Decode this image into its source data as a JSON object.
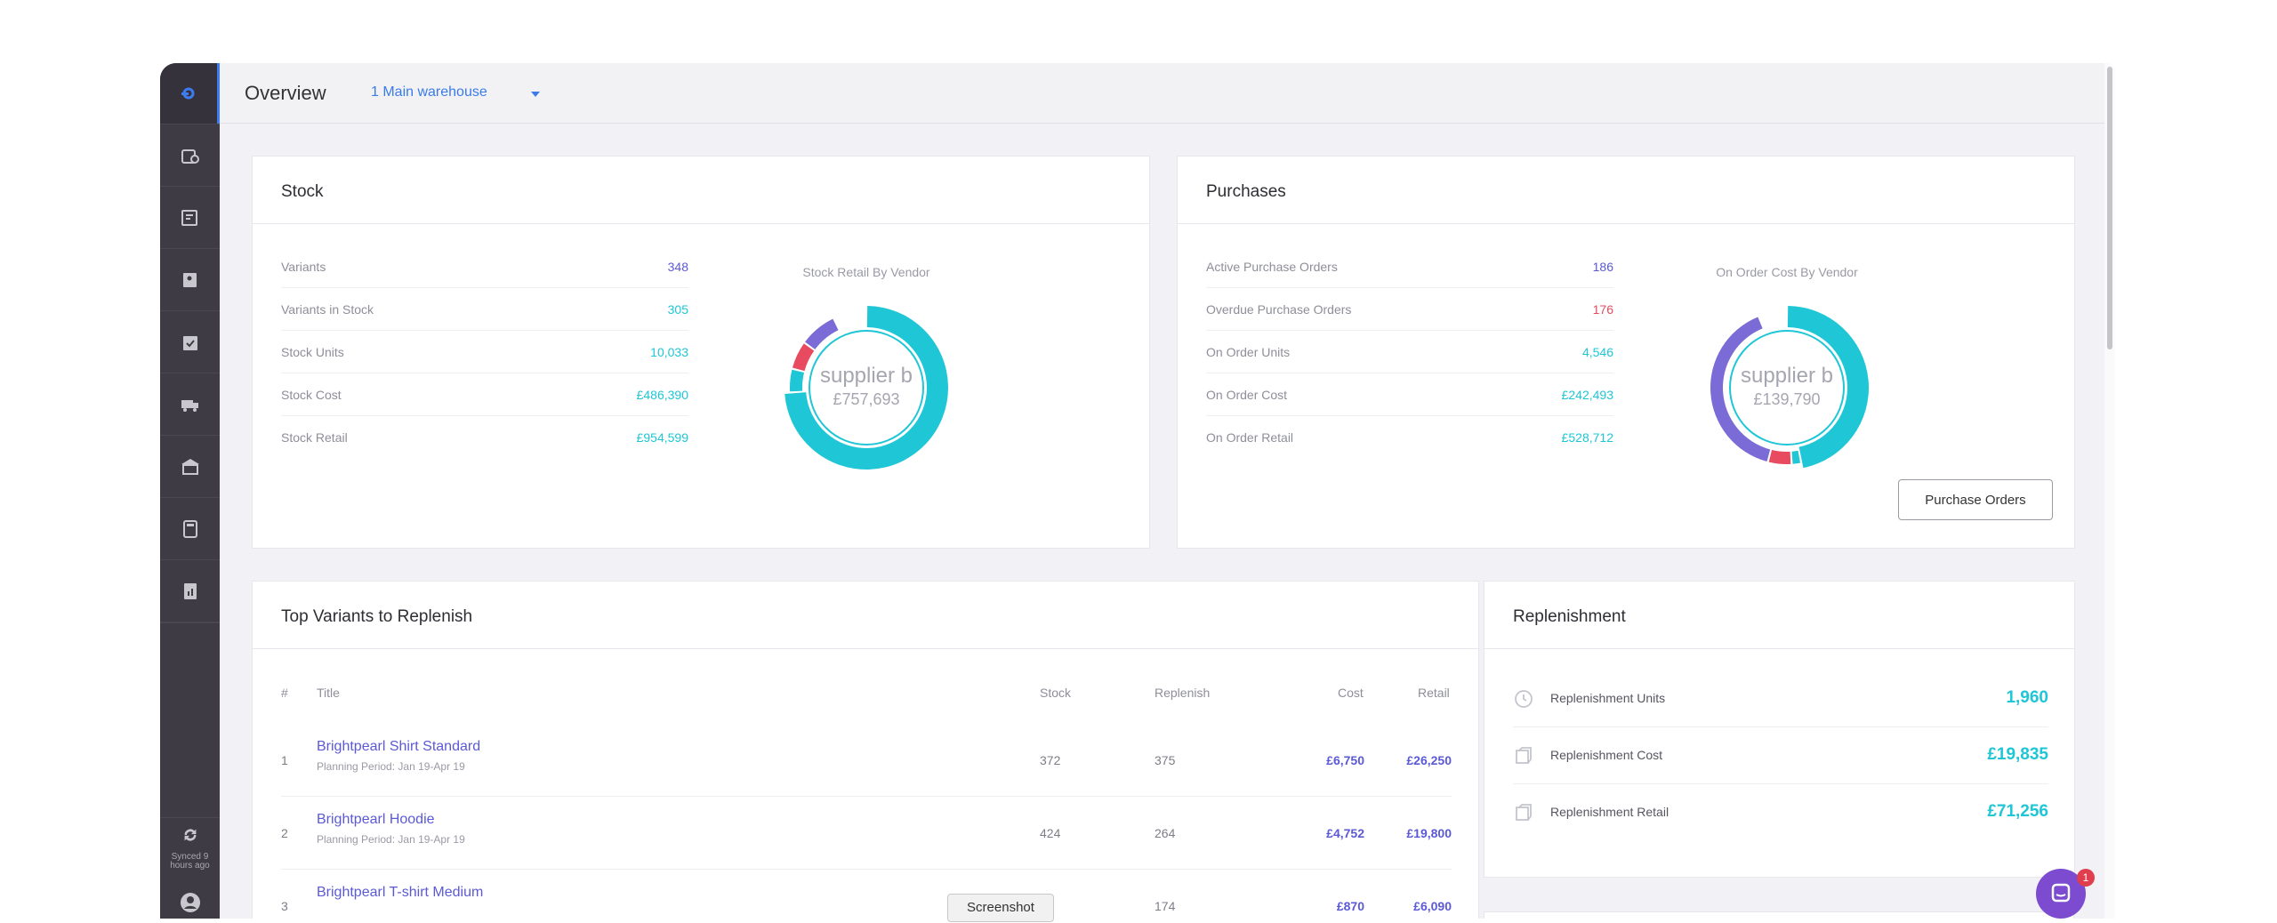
{
  "header": {
    "title": "Overview",
    "warehouse": "1 Main warehouse"
  },
  "sidebar": {
    "sync_label": "Synced 9 hours ago",
    "items": [
      "stock-icon",
      "orders-icon",
      "vendors-icon",
      "checklist-icon",
      "shipping-icon",
      "warehouse-icon",
      "calculator-icon",
      "reports-icon"
    ]
  },
  "stock": {
    "title": "Stock",
    "metrics": [
      {
        "label": "Variants",
        "value": "348",
        "color": "#5b59d6"
      },
      {
        "label": "Variants in Stock",
        "value": "305",
        "color": "#1ec6d6"
      },
      {
        "label": "Stock Units",
        "value": "10,033",
        "color": "#1ec6d6"
      },
      {
        "label": "Stock Cost",
        "value": "£486,390",
        "color": "#1ec6d6"
      },
      {
        "label": "Stock Retail",
        "value": "£954,599",
        "color": "#1ec6d6"
      }
    ],
    "donut": {
      "title": "Stock Retail By Vendor",
      "center_name": "supplier b",
      "center_value": "£757,693",
      "segments": [
        {
          "color": "#1ec6d6",
          "fraction": 0.74
        },
        {
          "color": "#1ec6d6",
          "fraction": 0.05
        },
        {
          "color": "#e84a60",
          "fraction": 0.06
        },
        {
          "color": "#7b6bd6",
          "fraction": 0.08
        }
      ]
    }
  },
  "purchases": {
    "title": "Purchases",
    "metrics": [
      {
        "label": "Active Purchase Orders",
        "value": "186",
        "color": "#5b59d6"
      },
      {
        "label": "Overdue Purchase Orders",
        "value": "176",
        "color": "#e84a60"
      },
      {
        "label": "On Order Units",
        "value": "4,546",
        "color": "#1ec6d6"
      },
      {
        "label": "On Order Cost",
        "value": "£242,493",
        "color": "#1ec6d6"
      },
      {
        "label": "On Order Retail",
        "value": "£528,712",
        "color": "#1ec6d6"
      }
    ],
    "donut": {
      "title": "On Order Cost By Vendor",
      "center_name": "supplier b",
      "center_value": "£139,790",
      "segments": [
        {
          "color": "#1ec6d6",
          "fraction": 0.47
        },
        {
          "color": "#1ec6d6",
          "fraction": 0.02
        },
        {
          "color": "#e84a60",
          "fraction": 0.05
        },
        {
          "color": "#7b6bd6",
          "fraction": 0.4
        }
      ]
    },
    "button": "Purchase Orders"
  },
  "top_variants": {
    "title": "Top Variants to Replenish",
    "columns": {
      "idx": "#",
      "title": "Title",
      "stock": "Stock",
      "replenish": "Replenish",
      "cost": "Cost",
      "retail": "Retail"
    },
    "rows": [
      {
        "idx": "1",
        "title": "Brightpearl Shirt Standard",
        "period": "Planning Period: Jan 19-Apr 19",
        "stock": "372",
        "replenish": "375",
        "cost": "£6,750",
        "retail": "£26,250"
      },
      {
        "idx": "2",
        "title": "Brightpearl Hoodie",
        "period": "Planning Period: Jan 19-Apr 19",
        "stock": "424",
        "replenish": "264",
        "cost": "£4,752",
        "retail": "£19,800"
      },
      {
        "idx": "3",
        "title": "Brightpearl T-shirt Medium",
        "period": "",
        "stock": "",
        "replenish": "174",
        "cost": "£870",
        "retail": "£6,090"
      }
    ]
  },
  "replenishment": {
    "title": "Replenishment",
    "rows": [
      {
        "label": "Replenishment Units",
        "value": "1,960",
        "icon": "clock-icon"
      },
      {
        "label": "Replenishment Cost",
        "value": "£19,835",
        "icon": "box-icon"
      },
      {
        "label": "Replenishment Retail",
        "value": "£71,256",
        "icon": "box-icon"
      }
    ]
  },
  "tooltip": "Screenshot",
  "chat": {
    "badge": "1"
  }
}
